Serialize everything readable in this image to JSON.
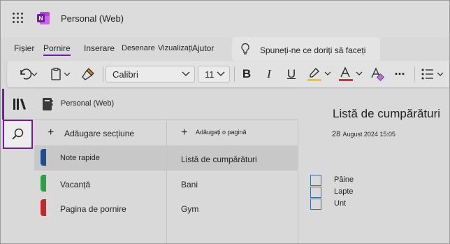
{
  "app": {
    "title": "Personal (Web)"
  },
  "tabs": [
    {
      "label": "Fișier"
    },
    {
      "label": "Pornire"
    },
    {
      "label": "Inserare"
    },
    {
      "label": "Desenare"
    },
    {
      "label": "Vizualizați"
    },
    {
      "label": "Ajutor"
    }
  ],
  "tell_me": {
    "text": "Spuneți-ne ce doriți să faceți"
  },
  "ribbon": {
    "font_name": "Calibri",
    "font_size": "11",
    "bold": "B",
    "italic": "I",
    "underline": "U",
    "font_color_letter": "A",
    "highlight_color": "#f2c811",
    "font_color": "#d13438",
    "more": "···"
  },
  "notebook": {
    "name": "Personal (Web)"
  },
  "sections": {
    "add_label": "Adăugare secțiune",
    "items": [
      {
        "label": "Note rapide",
        "color": "#1f4e8c"
      },
      {
        "label": "Vacanță",
        "color": "#2e9e48"
      },
      {
        "label": "Pagina de pornire",
        "color": "#c4262e"
      }
    ]
  },
  "pages": {
    "add_label": "Adăugați o pagină",
    "items": [
      {
        "label": "Listă de cumpărături"
      },
      {
        "label": "Bani"
      },
      {
        "label": "Gym"
      }
    ]
  },
  "page": {
    "title": "Listă de cumpărături",
    "date_day": "28",
    "date_rest": "August 2024 15:05",
    "todos": [
      {
        "text": "Pâine"
      },
      {
        "text": "Lapte"
      },
      {
        "text": "Unt"
      }
    ]
  },
  "colors": {
    "accent": "#7719aa",
    "checkbox": "#3e6aa8"
  },
  "icons": [
    "waffle-icon",
    "onenote-logo-icon",
    "lightbulb-icon",
    "undo-icon",
    "clipboard-icon",
    "format-painter-icon",
    "highlighter-icon",
    "font-color-icon",
    "clear-formatting-icon",
    "bullets-icon",
    "notebooks-icon",
    "search-icon",
    "notebook-icon",
    "plus-icon"
  ]
}
